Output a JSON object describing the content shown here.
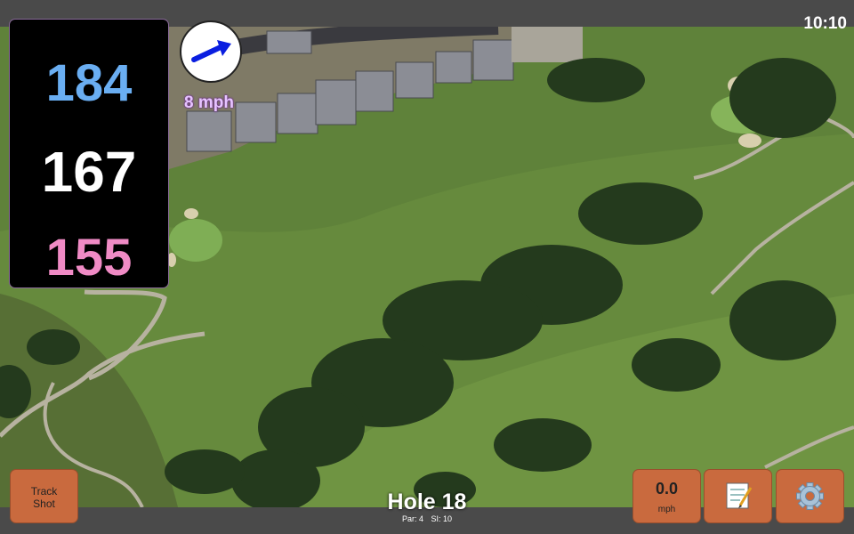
{
  "status": {
    "time": "10:10"
  },
  "yardages": {
    "back": "184",
    "middle": "167",
    "front": "155"
  },
  "wind": {
    "speed": "8 mph",
    "icon": "wind-direction-arrow-icon"
  },
  "buttons": {
    "track_shot_line1": "Track",
    "track_shot_line2": "Shot",
    "speed_value": "0.0",
    "speed_unit": "mph",
    "notes_icon": "notepad-icon",
    "settings_icon": "gear-icon"
  },
  "hole": {
    "title": "Hole 18",
    "par": "Par: 4",
    "si": "SI: 10"
  },
  "colors": {
    "back": "#6aaef2",
    "middle": "#ffffff",
    "front": "#f08bc5",
    "button": "#c96a3e"
  }
}
